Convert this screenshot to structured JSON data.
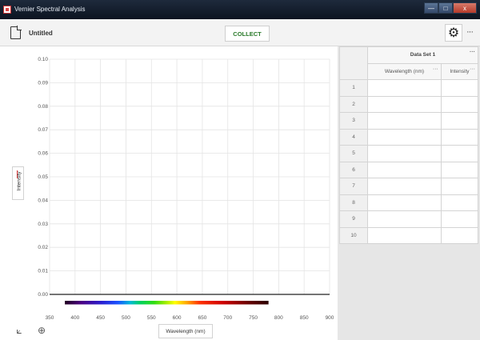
{
  "window": {
    "title": "Vernier Spectral Analysis",
    "min": "—",
    "max": "□",
    "close": "x"
  },
  "toolbar": {
    "doc_title": "Untitled",
    "collect_label": "COLLECT",
    "more": "···"
  },
  "graph": {
    "ylabel": "Intensity",
    "xlabel": "Wavelength (nm)",
    "yticks": [
      "0.10",
      "0.09",
      "0.08",
      "0.07",
      "0.06",
      "0.05",
      "0.04",
      "0.03",
      "0.02",
      "0.01",
      "0.00"
    ],
    "xticks": [
      "350",
      "400",
      "450",
      "500",
      "550",
      "600",
      "650",
      "700",
      "750",
      "800",
      "850",
      "900"
    ]
  },
  "chart_data": {
    "type": "line",
    "title": "",
    "xlabel": "Wavelength (nm)",
    "ylabel": "Intensity",
    "xlim": [
      350,
      900
    ],
    "ylim": [
      0.0,
      0.1
    ],
    "series": [],
    "grid": true,
    "spectrum_bar_range": [
      380,
      780
    ]
  },
  "table": {
    "dataset_name": "Data Set 1",
    "col1": "Wavelength (nm)",
    "col2": "Intensity",
    "dots": "···",
    "rows": [
      "1",
      "2",
      "3",
      "4",
      "5",
      "6",
      "7",
      "8",
      "9",
      "10"
    ]
  }
}
